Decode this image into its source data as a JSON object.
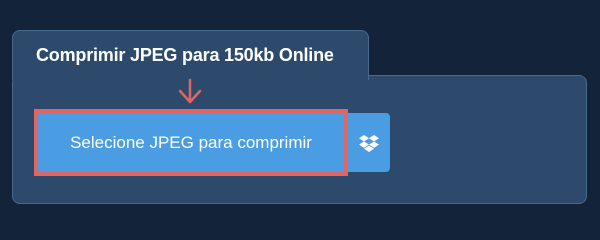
{
  "tab": {
    "title": "Comprimir JPEG para 150kb Online"
  },
  "upload": {
    "select_label": "Selecione JPEG para comprimir",
    "cloud_icon": "dropbox-icon"
  },
  "colors": {
    "page_background": "#13233a",
    "panel_background": "#2d4a6c",
    "button_background": "#4a9de2",
    "highlight": "#e06666",
    "text": "#ffffff"
  }
}
